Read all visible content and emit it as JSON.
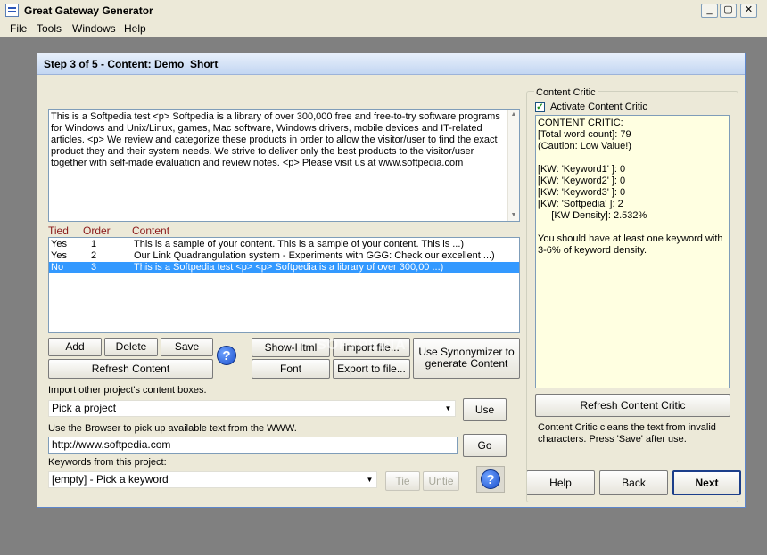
{
  "window": {
    "title": "Great Gateway Generator",
    "controls": {
      "minimize": "_",
      "maximize": "▢",
      "close": "✕"
    }
  },
  "menu": [
    "File",
    "Tools",
    "Windows",
    "Help"
  ],
  "child": {
    "title": "Step 3 of 5 - Content: Demo_Short"
  },
  "content_text": "This is a Softpedia test <p> Softpedia is a library of over 300,000 free and free-to-try software programs for Windows and Unix/Linux, games, Mac software, Windows drivers, mobile devices and IT-related articles. <p> We review and categorize these products in order to allow the visitor/user to find the exact product they and their system needs. We strive to deliver only the best products to the visitor/user together with self-made evaluation and review notes. <p> Please visit us at www.softpedia.com",
  "list": {
    "headers": {
      "tied": "Tied",
      "order": "Order",
      "content": "Content"
    },
    "rows": [
      {
        "tied": "Yes",
        "order": "1",
        "content": "This is a sample of your content. This is a sample of your content. This is ...)"
      },
      {
        "tied": "Yes",
        "order": "2",
        "content": "Our Link Quadrangulation system - Experiments with GGG: Check our excellent ...)"
      },
      {
        "tied": "No",
        "order": "3",
        "content": "This is a Softpedia test  <p>   <p>  Softpedia is a library of over 300,00 ...)"
      }
    ]
  },
  "buttons": {
    "add": "Add",
    "delete": "Delete",
    "save": "Save",
    "refresh_content": "Refresh Content",
    "show_html": "Show-Html",
    "import_file": "Import file...",
    "font": "Font",
    "export_file": "Export to file...",
    "synonymizer": "Use Synonymizer to generate Content",
    "use": "Use",
    "go": "Go",
    "tie": "Tie",
    "untie": "Untie",
    "help": "Help",
    "back": "Back",
    "next": "Next",
    "refresh_critic": "Refresh Content Critic"
  },
  "import": {
    "label": "Import other project's content boxes.",
    "value": "Pick a project"
  },
  "browser": {
    "label": "Use the Browser to pick up available text from the WWW.",
    "url": "http://www.softpedia.com"
  },
  "keywords": {
    "label": "Keywords from this project:",
    "value": "[empty] - Pick a keyword"
  },
  "critic": {
    "group_label": "Content Critic",
    "checkbox_label": "Activate Content Critic",
    "checked": true,
    "report": "CONTENT CRITIC:\n[Total word count]: 79\n(Caution: Low Value!)\n\n[KW: 'Keyword1' ]: 0\n[KW: 'Keyword2' ]: 0\n[KW: 'Keyword3' ]: 0\n[KW: 'Softpedia' ]: 2\n     [KW Density]: 2.532%\n\nYou should have at least one keyword with\n3-6% of keyword density.",
    "note": "Content Critic cleans the text from invalid characters. Press 'Save' after use."
  },
  "watermark": "SOFTPEDIA",
  "icons": {
    "help": "question-mark-icon",
    "dropdown": "chevron-down-icon"
  }
}
